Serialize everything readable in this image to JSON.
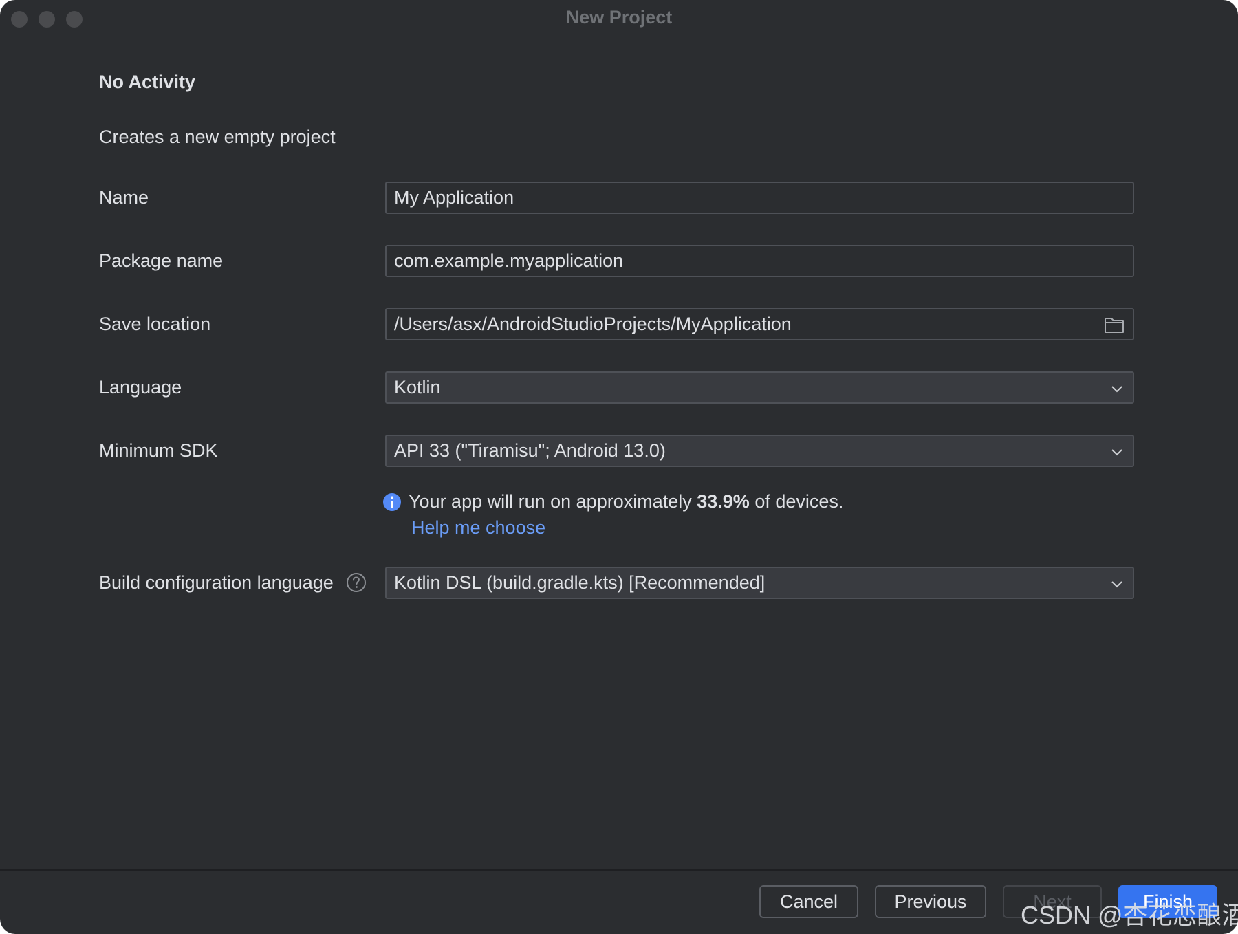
{
  "window": {
    "title": "New Project"
  },
  "heading": "No Activity",
  "subtitle": "Creates a new empty project",
  "form": {
    "name_label": "Name",
    "name_value": "My Application",
    "package_label": "Package name",
    "package_value": "com.example.myapplication",
    "location_label": "Save location",
    "location_value": "/Users/asx/AndroidStudioProjects/MyApplication",
    "language_label": "Language",
    "language_value": "Kotlin",
    "sdk_label": "Minimum SDK",
    "sdk_value": "API 33 (\"Tiramisu\"; Android 13.0)",
    "sdk_info_prefix": "Your app will run on approximately ",
    "sdk_info_percent": "33.9%",
    "sdk_info_suffix": " of devices.",
    "help_link": "Help me choose",
    "build_label": "Build configuration language",
    "build_value": "Kotlin DSL (build.gradle.kts) [Recommended]"
  },
  "footer": {
    "cancel": "Cancel",
    "previous": "Previous",
    "next": "Next",
    "finish": "Finish"
  },
  "watermark": "CSDN @杏花恋酿酒",
  "colors": {
    "background": "#2b2d30",
    "text": "#dfe1e5",
    "link": "#6a9cf6",
    "primary": "#3574f0"
  },
  "icons": [
    "folder-icon",
    "chevron-down-icon",
    "info-icon",
    "help-icon"
  ]
}
